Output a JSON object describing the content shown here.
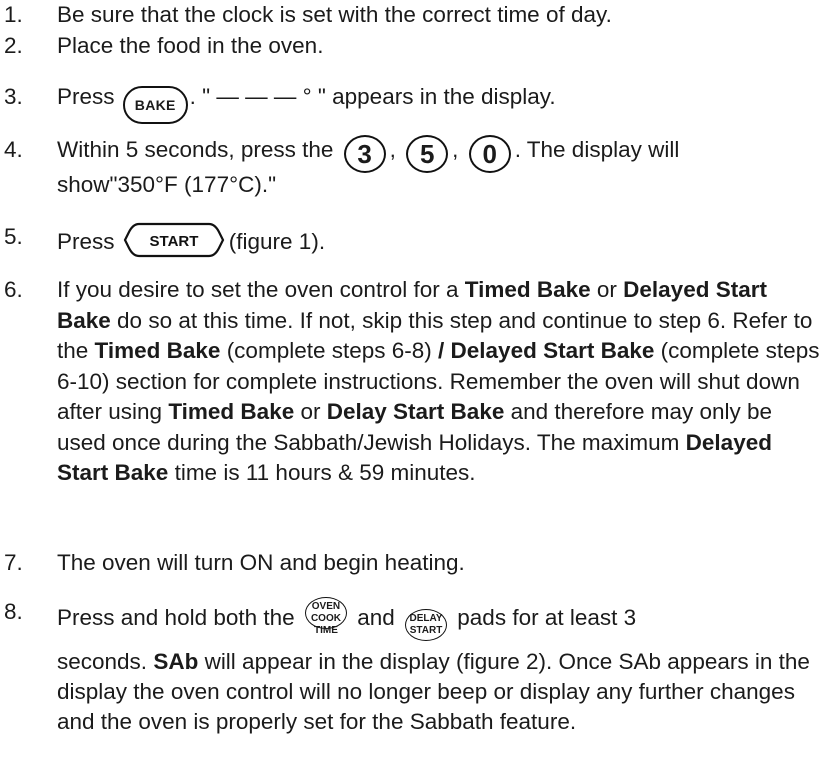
{
  "steps": [
    {
      "num": "1.",
      "text": "Be sure that the clock is set with the correct time of day."
    },
    {
      "num": "2.",
      "text": "Place the food in the oven."
    },
    {
      "num": "3.",
      "pre": "Press",
      "key": "BAKE",
      "post": ". \" — — — ° \" appears in the display."
    },
    {
      "num": "4.",
      "pre": "Within 5 seconds, press the",
      "keys": [
        "3",
        "5",
        "0"
      ],
      "post": ". The display will",
      "line2": "show\"350°F (177°C).\""
    },
    {
      "num": "5.",
      "pre": "Press",
      "key": "START",
      "post": "(figure 1)."
    },
    {
      "num": "6.",
      "parts": {
        "a": "If you desire to set the oven control for a ",
        "b1": "Timed Bake",
        "c": " or ",
        "b2": "Delayed Start Bake",
        "d": " do so at this time. If not, skip this step and continue to step 6. Refer to the ",
        "b3": "Timed Bake",
        "e": " (complete steps 6-8) ",
        "b4": "/ Delayed Start Bake",
        "f": " (complete steps 6-10) section for complete instructions. Remember the oven will shut down after using ",
        "b5": "Timed Bake",
        "g": " or ",
        "b6": "Delay Start Bake",
        "h": " and therefore may only be used once during the Sabbath/Jewish Holidays. The maximum ",
        "b7": "Delayed Start Bake",
        "i": " time is 11 hours & 59 minutes."
      }
    },
    {
      "num": "7.",
      "text": "The oven will turn ON and begin heating."
    },
    {
      "num": "8.",
      "pre": "Press and hold both the",
      "key1": [
        "OVEN COOK",
        "TIME"
      ],
      "mid": "and",
      "key2": [
        "DELAY",
        "START"
      ],
      "post": "pads for at least 3",
      "p2a": "seconds. ",
      "p2b": "SAb",
      "p2c": " will appear in the display (figure 2). Once SAb appears in the display the oven control will no longer beep or display any further changes and the oven is properly set for the Sabbath feature."
    }
  ]
}
